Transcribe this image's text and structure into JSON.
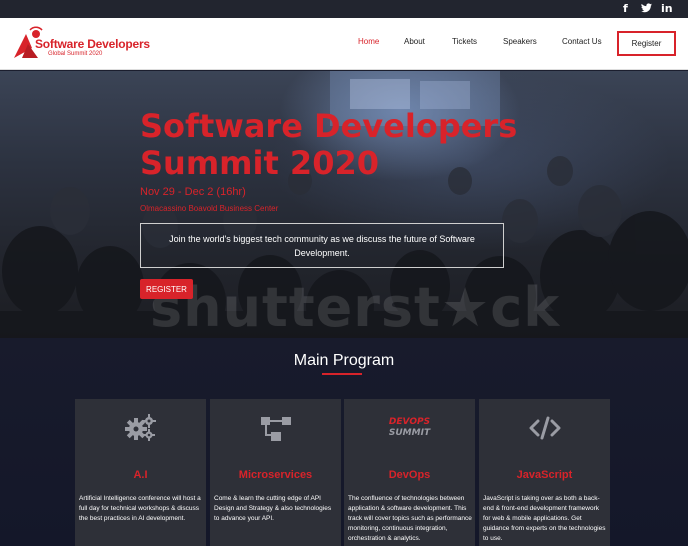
{
  "topbar": {
    "social": [
      "f",
      "t",
      "in"
    ]
  },
  "navbar": {
    "logo_title": "Software Developers",
    "logo_subtitle": "Global Summit 2020",
    "links": [
      "Home",
      "About",
      "Tickets",
      "Speakers",
      "Contact Us"
    ],
    "register_label": "Register"
  },
  "hero": {
    "title": "Software Developers Summit 2020",
    "dates": "Nov 29 - Dec 2 (16hr)",
    "venue": "Olmacassino Boavold Business Center",
    "description": "Join the world's biggest tech community as we discuss the future of Software Development.",
    "register_label": "REGISTER",
    "watermark": "shutterst★ck"
  },
  "program": {
    "title": "Main Program",
    "cards": [
      {
        "icon": "gears-icon",
        "title": "A.I",
        "description": "Artificial Intelligence conference will host a full day for technical workshops & discuss the best practices in AI development."
      },
      {
        "icon": "flowchart-icon",
        "title": "Microservices",
        "description": "Come & learn the cutting edge of API Design and Strategy & also technologies to advance your API."
      },
      {
        "icon": "devops-summit-logo",
        "logo_line1": "DEVOPS",
        "logo_line2": "SUMMIT",
        "title": "DevOps",
        "description": "The confluence of technologies between application & software development. This track will cover topics such as performance monitoring, continuous integration, orchestration & analytics."
      },
      {
        "icon": "code-icon",
        "title": "JavaScript",
        "description": "JavaScript is taking over as both a back-end & front-end development framework for web & mobile applications. Get guidance from experts on the technologies to use."
      }
    ]
  },
  "colors": {
    "accent": "#d8232a",
    "dark_bg": "#1b1e2e",
    "card_bg": "#2e3038"
  }
}
